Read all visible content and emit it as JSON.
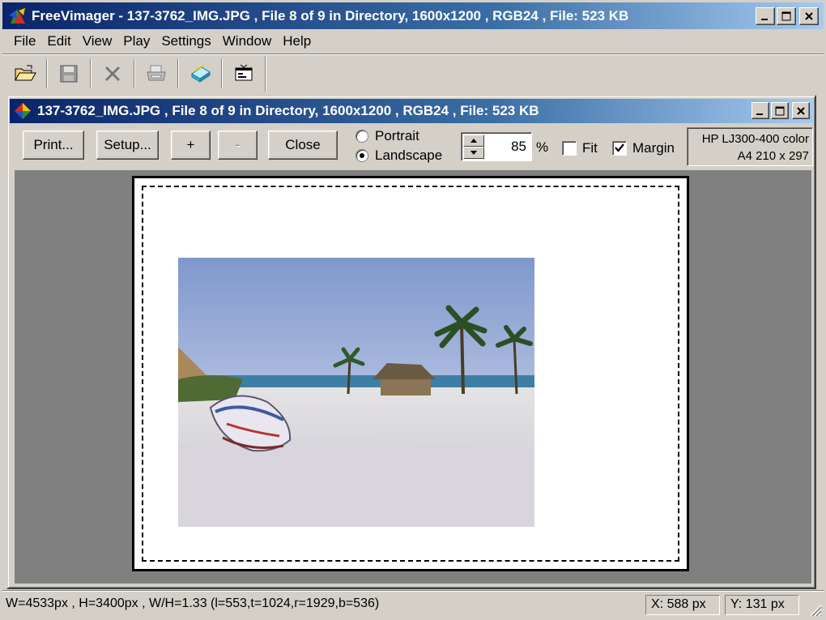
{
  "app": {
    "title": "FreeVimager - 137-3762_IMG.JPG , File 8 of 9 in Directory, 1600x1200 , RGB24 , File: 523 KB"
  },
  "menu": [
    "File",
    "Edit",
    "View",
    "Play",
    "Settings",
    "Window",
    "Help"
  ],
  "toolbar": {
    "icons": [
      "open-folder-icon",
      "save-icon",
      "delete-icon",
      "print-icon",
      "scan-icon",
      "properties-icon"
    ]
  },
  "child_window": {
    "title": "137-3762_IMG.JPG , File 8 of 9 in Directory, 1600x1200 , RGB24 , File: 523 KB"
  },
  "print_preview": {
    "print_label": "Print...",
    "setup_label": "Setup...",
    "zoom_in_label": "+",
    "zoom_out_label": "-",
    "close_label": "Close",
    "portrait_label": "Portrait",
    "landscape_label": "Landscape",
    "orientation_selected": "Landscape",
    "scale_value": "85",
    "percent_label": "%",
    "fit_label": "Fit",
    "fit_checked": false,
    "margin_label": "Margin",
    "margin_checked": true,
    "printer_name": "HP LJ300-400 color",
    "paper": "A4 210 x 297"
  },
  "statusbar": {
    "main": "W=4533px , H=3400px , W/H=1.33 (l=553,t=1024,r=1929,b=536)",
    "x": "X: 588 px",
    "y": "Y: 131 px"
  },
  "colors": {
    "titlebar_active_start": "#0a246a",
    "titlebar_active_end": "#a6caf0",
    "face": "#d4d0c8",
    "preview_background": "#808080"
  }
}
